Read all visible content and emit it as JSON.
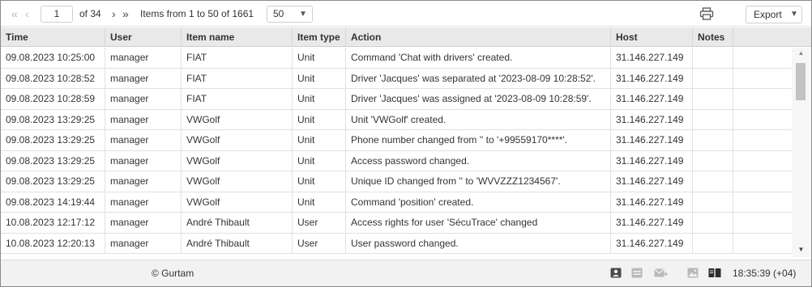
{
  "toolbar": {
    "first_page": "«",
    "prev_page": "‹",
    "current_page": "1",
    "of_pages": "of 34",
    "next_page": "›",
    "last_page": "»",
    "items_summary": "Items from 1 to 50 of 1661",
    "per_page": "50",
    "export_label": "Export"
  },
  "table": {
    "columns": [
      "Time",
      "User",
      "Item name",
      "Item type",
      "Action",
      "Host",
      "Notes"
    ],
    "rows": [
      {
        "time": "09.08.2023 10:25:00",
        "user": "manager",
        "item": "FIAT",
        "type": "Unit",
        "action": "Command 'Chat with drivers' created.",
        "host": "31.146.227.149",
        "notes": ""
      },
      {
        "time": "09.08.2023 10:28:52",
        "user": "manager",
        "item": "FIAT",
        "type": "Unit",
        "action": "Driver 'Jacques' was separated at '2023-08-09 10:28:52'.",
        "host": "31.146.227.149",
        "notes": ""
      },
      {
        "time": "09.08.2023 10:28:59",
        "user": "manager",
        "item": "FIAT",
        "type": "Unit",
        "action": "Driver 'Jacques' was assigned at '2023-08-09 10:28:59'.",
        "host": "31.146.227.149",
        "notes": ""
      },
      {
        "time": "09.08.2023 13:29:25",
        "user": "manager",
        "item": "VWGolf",
        "type": "Unit",
        "action": "Unit 'VWGolf' created.",
        "host": "31.146.227.149",
        "notes": ""
      },
      {
        "time": "09.08.2023 13:29:25",
        "user": "manager",
        "item": "VWGolf",
        "type": "Unit",
        "action": "Phone number changed from '' to '+99559170****'.",
        "host": "31.146.227.149",
        "notes": ""
      },
      {
        "time": "09.08.2023 13:29:25",
        "user": "manager",
        "item": "VWGolf",
        "type": "Unit",
        "action": "Access password changed.",
        "host": "31.146.227.149",
        "notes": ""
      },
      {
        "time": "09.08.2023 13:29:25",
        "user": "manager",
        "item": "VWGolf",
        "type": "Unit",
        "action": "Unique ID changed from '' to 'WVVZZZ1234567'.",
        "host": "31.146.227.149",
        "notes": ""
      },
      {
        "time": "09.08.2023 14:19:44",
        "user": "manager",
        "item": "VWGolf",
        "type": "Unit",
        "action": "Command 'position' created.",
        "host": "31.146.227.149",
        "notes": ""
      },
      {
        "time": "10.08.2023 12:17:12",
        "user": "manager",
        "item": "André Thibault",
        "type": "User",
        "action": "Access rights for user 'SécuTrace' changed",
        "host": "31.146.227.149",
        "notes": ""
      },
      {
        "time": "10.08.2023 12:20:13",
        "user": "manager",
        "item": "André Thibault",
        "type": "User",
        "action": "User password changed.",
        "host": "31.146.227.149",
        "notes": ""
      }
    ]
  },
  "footer": {
    "copyright": "© Gurtam",
    "clock": "18:35:39 (+04)"
  },
  "icons": {
    "print": "printer-icon",
    "footer": [
      "contact-card-icon",
      "notification-window-icon",
      "mail-icon",
      "image-icon",
      "book-icon"
    ]
  }
}
